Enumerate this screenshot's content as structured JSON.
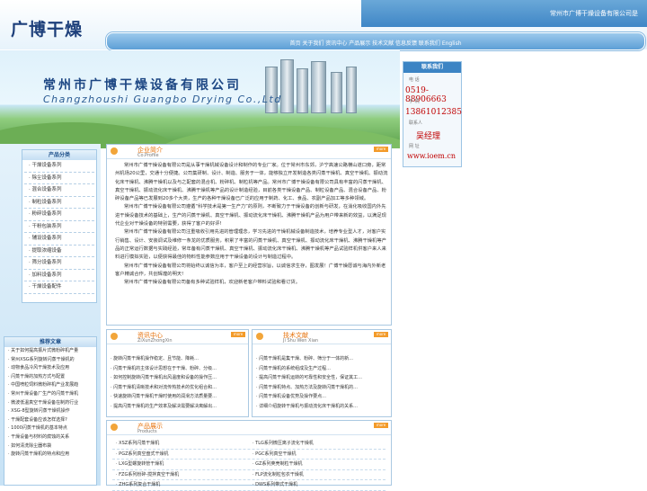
{
  "header": {
    "logo": "广博干燥",
    "company_top": "常州市广博干燥设备有限公司是",
    "nav": "首页 关于我们 资讯中心 产品展示 技术文献 信息反馈 联系我们 English"
  },
  "banner": {
    "company_cn": "常州市广博干燥设备有限公司",
    "company_en": "Changzhoushi Guangbo Drying Co.,Ltd"
  },
  "contact": {
    "title": "联系我们",
    "phone_label": "电 话",
    "phone": "0519-88906663",
    "mobile_label": "手 机",
    "mobile": "13861012385",
    "person_label": "联系人",
    "person": "吴经理",
    "web_label": "网 址",
    "web": "www.ioem.cn"
  },
  "categories": {
    "title": "产品分类",
    "items": [
      "干燥设备系列",
      "除尘设备系列",
      "混合设备系列",
      "制粒设备系列",
      "粉碎设备系列",
      "干粉包装系列",
      "辅设设备系列",
      "提取浓缩设备",
      "筛分设备系列",
      "加料设备系列",
      "干燥设备配件"
    ]
  },
  "recommended": {
    "title": "推荐文章",
    "items": [
      "关于如何提高振片式微粉碎机产量",
      "常州XSG系列旋转闪蒸干燥机的",
      "动物食品冷风干燥技术及应用",
      "闪蒸干燥的加热方式与配置",
      "中国喷粒饲料微粉碎机产业发展趋",
      "常州干燥设备厂生产的闪蒸干燥机",
      "微波低温真空干燥设备在制药行业",
      "XSG-8型旋转闪蒸干燥机操作",
      "干燥配套设备应该怎样选择?",
      "1000闪蒸干燥机的基本特点",
      "干燥设备与材料的腐蚀的关系",
      "如何清洗除尘器布袋",
      "旋转闪蒸干燥机的特点和应用"
    ]
  },
  "about": {
    "title": "企业简介",
    "subtitle": "Co.Profile",
    "more": "more",
    "paragraphs": [
      "常州市广博干燥设备有限公司是从事干燥机械设备设计和制作的专业厂家。位于常州市东郊，沪宁高速公路横山道口旁，距常州机场20公里，交通十分便捷。公司集研制、设计、制造、服务于一体，能够独立开发制造各类闪蒸干燥机、真空干燥机、振动流化床干燥机、沸腾干燥机以及与之配套的混合机、粉碎机、制粒机等产品。常州市广博干燥设备有限公司具有丰富的闪蒸干燥机、真空干燥机、振动流化床干燥机、沸腾干燥机等产品的设计制造经验，目前各类干燥设备产品、制粒设备产品、混合设备产品、粉碎设备产品等已发展到20多个大类，生产的各种干燥设备已广泛的应用于制药、化工、食品、农副产品加工等多种领域。",
      "常州市广博干燥设备有限公司遵循“科学技术是第一生产力”的原则，不断致力于干燥设备的创新与研发，在消化吸收国内外先进干燥设备技术的基础上，生产的闪蒸干燥机、真空干燥机、振动流化床干燥机、沸腾干燥机产品为用户带来新的效益，以满足现代企业对干燥设备的特别需要，获得了客户的好评!",
      "常州市广博干燥设备有限公司注重吸收引用先进的管理理念，学习先进的干燥机械设备制造技术，培养专业型人才，对客户实行销售、设计、安装调试及维修一条龙的优质服务，积累了丰富的闪蒸干燥机、真空干燥机、振动流化床干燥机、沸腾干燥机等产品的正常运行数据与实践经验，常年备有闪蒸干燥机、真空干燥机、振动流化床干燥机、沸腾干燥机等产品试验样机供客户来人来料进行模拟实验，以便获得最佳的物料性能参数应用于干燥设备的设计与制造过程中。",
      "常州市广博干燥设备有限公司将始终以诚信为本，客户至上的经营宗旨，以诚信求生存，图发展！广博干燥愿诚与海内外新老客户精诚合作，共创辉煌的明天!",
      "常州市广博干燥设备有限公司备有多种试验样机，欢迎新老客户带料试验和看订货。"
    ]
  },
  "news": {
    "title": "资讯中心",
    "subtitle": "ZiXunZhongXin",
    "items": [
      "旋转闪蒸干燥机操作稳定、且节能、降耗...",
      "闪蒸干燥机的主体设计思想在于干燥、粉碎、分级...",
      "如何控制旋转闪蒸干燥机出风温度和设备的操作压...",
      "闪蒸干燥机清晰技术和对流传热技术的优化组合和...",
      "快速旋转闪蒸干燥机干燥时使用的润滑方法质量要...",
      "提高闪蒸干燥机的生产效率及解决需要解决离解出..."
    ]
  },
  "tech": {
    "title": "技术文献",
    "subtitle": "Ji Shu Wen Xian",
    "items": [
      "闪蒸干燥机是集干燥、粉碎、筛分于一体的新...",
      "闪蒸干燥机的系统组成及生产过程...",
      "提高闪蒸干燥机运转的可靠性和安全性，保证其工...",
      "闪蒸干燥机特点、加热方法及旋转闪蒸干燥机的...",
      "闪蒸干燥机设备优势及操作要点...",
      "详细介绍旋转干燥机与振动流化床干燥机的关系..."
    ]
  },
  "products": {
    "title": "产品展示",
    "subtitle": "Products",
    "rows": [
      [
        "XSZ系列闪蒸干燥机",
        "TLG系列微压离子流化干燥机"
      ],
      [
        "PGZ系列真空盘式干燥机",
        "PGC系列真空干燥机"
      ],
      [
        "LXG型螺旋转管干燥机",
        "GZ系列荚壳制粒干燥机"
      ],
      [
        "FZG系列粉碎-搅拌真空干燥机",
        "FLP流化制粒包衣干燥机"
      ],
      [
        "ZHG系列复合干燥机",
        "DWS系列带式干燥机"
      ]
    ]
  }
}
